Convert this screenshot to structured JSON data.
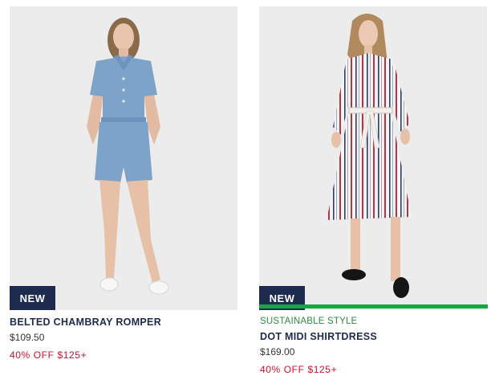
{
  "products": [
    {
      "badge": "NEW",
      "name": "BELTED CHAMBRAY ROMPER",
      "price": "$109.50",
      "promo": "40% OFF $125+"
    },
    {
      "badge": "NEW",
      "tag": "SUSTAINABLE STYLE",
      "name": "DOT MIDI SHIRTDRESS",
      "price": "$169.00",
      "promo": "40% OFF $125+"
    }
  ],
  "colors": {
    "badge_bg": "#1f2a4f",
    "name": "#1f2a4f",
    "promo": "#c8102e",
    "sustainable": "#2e8b3e",
    "sustainable_bar": "#18a640"
  }
}
